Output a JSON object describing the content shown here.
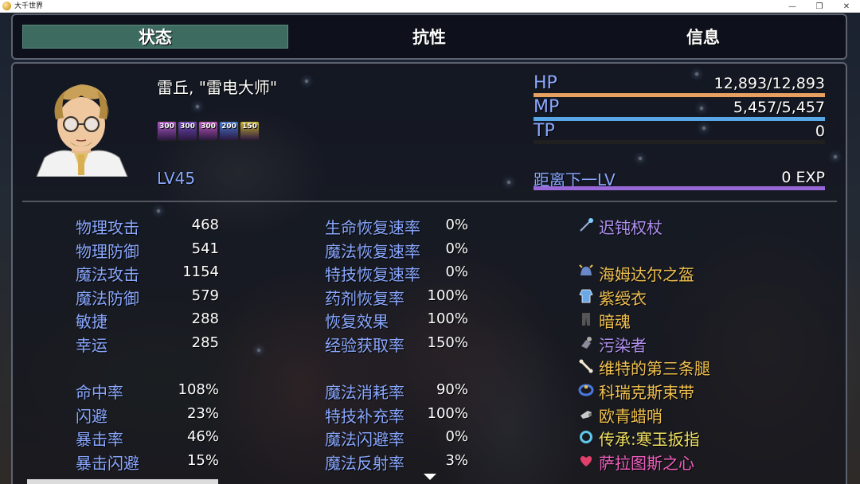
{
  "window": {
    "title": "大千世界",
    "minimize": "—",
    "restore": "❐",
    "close": "✕"
  },
  "tabs": [
    "状态",
    "抗性",
    "信息"
  ],
  "active_tab": "状态",
  "character": {
    "name": "雷丘, \"雷电大师\"",
    "level": "LV45",
    "buffs": [
      {
        "value": "300",
        "color": "#b05ac8"
      },
      {
        "value": "300",
        "color": "#7048b8"
      },
      {
        "value": "300",
        "color": "#c058c0"
      },
      {
        "value": "200",
        "color": "#4878d0"
      },
      {
        "value": "150",
        "color": "#c8b030"
      }
    ]
  },
  "gauges": {
    "hp": {
      "label": "HP",
      "value": "12,893/12,893",
      "fraction": 1.0,
      "color": "#e8a060"
    },
    "mp": {
      "label": "MP",
      "value": "5,457/5,457",
      "fraction": 1.0,
      "color": "#58a8e8"
    },
    "tp": {
      "label": "TP",
      "value": "0",
      "fraction": 0.0,
      "color": "#70c070"
    },
    "exp": {
      "label": "距离下一LV",
      "value": "0 EXP",
      "fraction": 1.0,
      "color": "#9868d8"
    }
  },
  "stats_col1": [
    {
      "label": "物理攻击",
      "value": "468"
    },
    {
      "label": "物理防御",
      "value": "541"
    },
    {
      "label": "魔法攻击",
      "value": "1154"
    },
    {
      "label": "魔法防御",
      "value": "579"
    },
    {
      "label": "敏捷",
      "value": "288"
    },
    {
      "label": "幸运",
      "value": "285"
    }
  ],
  "stats_col1b": [
    {
      "label": "命中率",
      "value": "108%"
    },
    {
      "label": "闪避",
      "value": "23%"
    },
    {
      "label": "暴击率",
      "value": "46%"
    },
    {
      "label": "暴击闪避",
      "value": "15%"
    }
  ],
  "stats_col2": [
    {
      "label": "生命恢复速率",
      "value": "0%"
    },
    {
      "label": "魔法恢复速率",
      "value": "0%"
    },
    {
      "label": "特技恢复速率",
      "value": "0%"
    },
    {
      "label": "药剂恢复率",
      "value": "100%"
    },
    {
      "label": "恢复效果",
      "value": "100%"
    },
    {
      "label": "经验获取率",
      "value": "150%"
    }
  ],
  "stats_col2b": [
    {
      "label": "魔法消耗率",
      "value": "90%"
    },
    {
      "label": "特技补充率",
      "value": "100%"
    },
    {
      "label": "魔法闪避率",
      "value": "0%"
    },
    {
      "label": "魔法反射率",
      "value": "3%"
    }
  ],
  "equipment": [
    {
      "name": "迟钝权杖",
      "icon": "staff-icon",
      "color": "#b090f0"
    },
    {
      "name": "海姆达尔之盔",
      "icon": "helmet-icon",
      "color": "#f0c050"
    },
    {
      "name": "紫绶衣",
      "icon": "robe-icon",
      "color": "#f0c050"
    },
    {
      "name": "暗魂",
      "icon": "leggings-icon",
      "color": "#f0c050"
    },
    {
      "name": "污染者",
      "icon": "gauntlet-icon",
      "color": "#b090f0"
    },
    {
      "name": "维特的第三条腿",
      "icon": "bone-icon",
      "color": "#f0c050"
    },
    {
      "name": "科瑞克斯束带",
      "icon": "belt-icon",
      "color": "#f0c050"
    },
    {
      "name": "欧青蜡哨",
      "icon": "whistle-icon",
      "color": "#f0c050"
    },
    {
      "name": "传承:寒玉扳指",
      "icon": "ring-icon",
      "color": "#f0e060"
    },
    {
      "name": "萨拉图斯之心",
      "icon": "heart-icon",
      "color": "#f060c0"
    }
  ]
}
